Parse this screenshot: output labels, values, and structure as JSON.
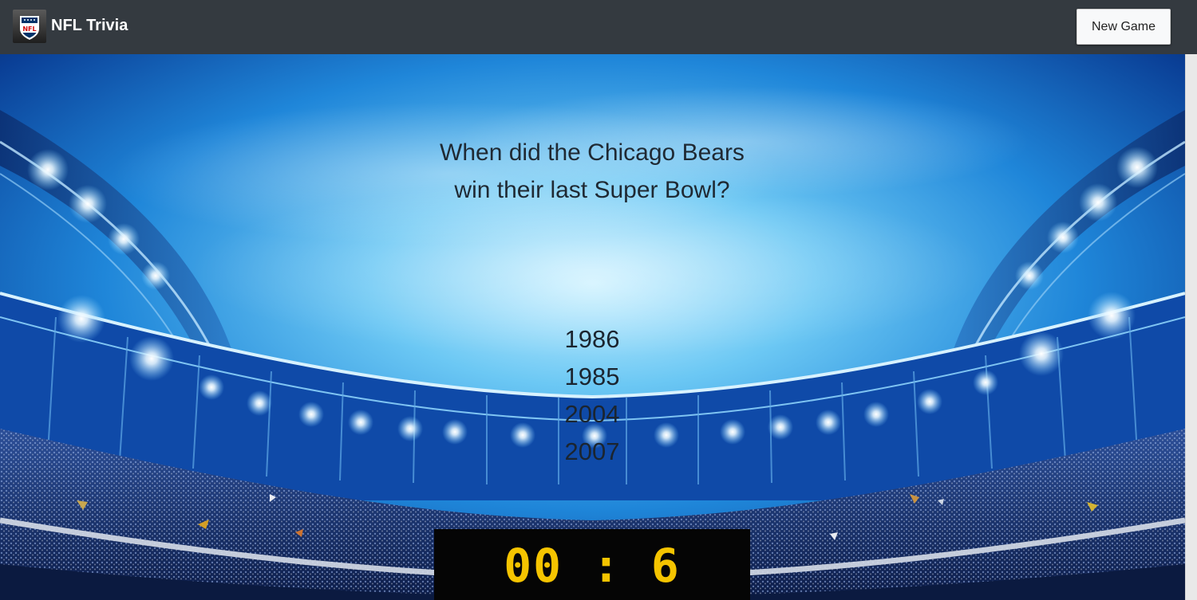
{
  "app": {
    "title": "NFL Trivia",
    "logo_icon": "nfl-shield-logo-icon",
    "logo_text": "NFL"
  },
  "navbar": {
    "new_game_label": "New Game"
  },
  "question": {
    "text": "When did the Chicago Bears win their last Super Bowl?"
  },
  "answers": [
    "1986",
    "1985",
    "2004",
    "2007"
  ],
  "timer": {
    "minutes": "00",
    "separator": ":",
    "seconds": "6"
  },
  "colors": {
    "navbar": "#343a40",
    "timer_digits": "#f5c400",
    "scoreboard": "#050505"
  }
}
